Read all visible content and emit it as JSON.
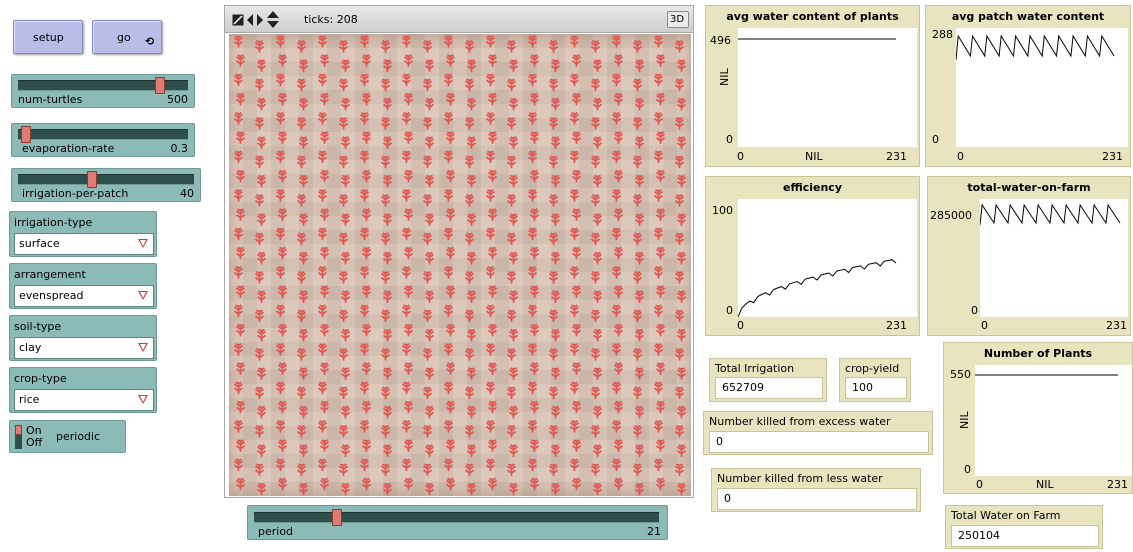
{
  "buttons": {
    "setup": "setup",
    "go": "go"
  },
  "sliders": [
    {
      "id": "num-turtles",
      "label": "num-turtles",
      "value": "500",
      "fraction": 0.94
    },
    {
      "id": "evaporation-rate",
      "label": "evaporation-rate",
      "value": "0.3",
      "fraction": 0.02
    },
    {
      "id": "irrigation-per-patch",
      "label": "irrigation-per-patch",
      "value": "40",
      "fraction": 0.4
    }
  ],
  "choosers": [
    {
      "id": "irrigation-type",
      "label": "irrigation-type",
      "value": "surface"
    },
    {
      "id": "arrangement",
      "label": "arrangement",
      "value": "evenspread"
    },
    {
      "id": "soil-type",
      "label": "soil-type",
      "value": "clay"
    },
    {
      "id": "crop-type",
      "label": "crop-type",
      "value": "rice"
    }
  ],
  "switch": {
    "label": "periodic",
    "on": "On",
    "off": "Off"
  },
  "world": {
    "ticks": "ticks: 208",
    "three_d": "3D",
    "plant_color": "#e05a55"
  },
  "period_slider": {
    "label": "period",
    "value": "21",
    "fraction": 0.2
  },
  "plots": {
    "avg_water_plants": {
      "title": "avg water content of plants",
      "ymax": "496",
      "ymin": "0",
      "xmin": "0",
      "xmax": "231",
      "xlabel": "NIL",
      "ylabel": "NIL"
    },
    "avg_patch_water": {
      "title": "avg patch water content",
      "ymax": "288",
      "ymin": "0",
      "xmin": "0",
      "xmax": "231"
    },
    "efficiency": {
      "title": "efficiency",
      "ymax": "100",
      "ymin": "0",
      "xmin": "0",
      "xmax": "231"
    },
    "total_water_farm": {
      "title": "total-water-on-farm",
      "ymax": "285000",
      "ymin": "0",
      "xmin": "0",
      "xmax": "231"
    },
    "number_of_plants": {
      "title": "Number of Plants",
      "ymax": "550",
      "ymin": "0",
      "xmin": "0",
      "xmax": "231",
      "xlabel": "NIL",
      "ylabel": "NIL"
    }
  },
  "monitors": {
    "total_irrigation": {
      "label": "Total Irrigation",
      "value": "652709"
    },
    "crop_yield": {
      "label": "crop-yield",
      "value": "100"
    },
    "killed_excess": {
      "label": "Number killed from excess water",
      "value": "0"
    },
    "killed_less": {
      "label": "Number killed from less water",
      "value": "0"
    },
    "total_water_on_farm": {
      "label": "Total Water on Farm",
      "value": "250104"
    }
  }
}
